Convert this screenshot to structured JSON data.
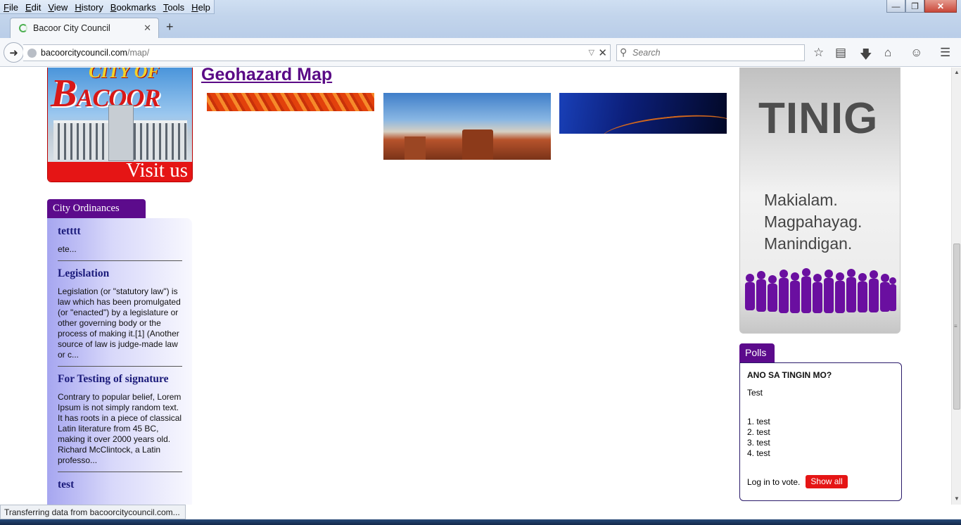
{
  "menubar": {
    "items": [
      {
        "u": "F",
        "rest": "ile"
      },
      {
        "u": "E",
        "rest": "dit"
      },
      {
        "u": "V",
        "rest": "iew"
      },
      {
        "u": "H",
        "rest": "istory"
      },
      {
        "u": "B",
        "rest": "ookmarks"
      },
      {
        "u": "T",
        "rest": "ools"
      },
      {
        "u": "H",
        "rest": "elp"
      }
    ]
  },
  "tab": {
    "title": "Bacoor City Council"
  },
  "navbar": {
    "url_host": "bacoorcitycouncil.com",
    "url_path": "/map/",
    "search_placeholder": "Search"
  },
  "logo": {
    "line1": "CITY OF",
    "line2_big": "B",
    "line2_rest": "ACOOR",
    "visit": "Visit us"
  },
  "ordinances": {
    "tab_label": "City Ordinances",
    "items": [
      {
        "title": "tetttt",
        "text": "ete..."
      },
      {
        "title": "Legislation",
        "text": "Legislation (or \"statutory law\") is law which has been promulgated (or \"enacted\") by a legislature or other governing body or the process of making it.[1] (Another source of law is judge-made law or c..."
      },
      {
        "title": "For Testing of signature",
        "text": "Contrary to popular belief, Lorem Ipsum is not simply random text. It has roots in a piece of classical Latin literature from 45 BC, making it over 2000 years old. Richard McClintock, a Latin professo..."
      },
      {
        "title": "test",
        "text": ""
      }
    ]
  },
  "main": {
    "title": "Geohazard Map"
  },
  "tinig": {
    "big": "TINIG",
    "slogan": [
      "Makialam.",
      "Magpahayag.",
      "Manindigan."
    ]
  },
  "polls": {
    "tab_label": "Polls",
    "question": "ANO SA TINGIN MO?",
    "description": "Test",
    "options": [
      "1. test",
      "2. test",
      "3. test",
      "4. test"
    ],
    "login_text": "Log in to vote.",
    "show_all": "Show all"
  },
  "status": {
    "text": "Transferring data from bacoorcitycouncil.com..."
  },
  "colors": {
    "accent_purple": "#5c0b8c",
    "button_red": "#e51515"
  }
}
